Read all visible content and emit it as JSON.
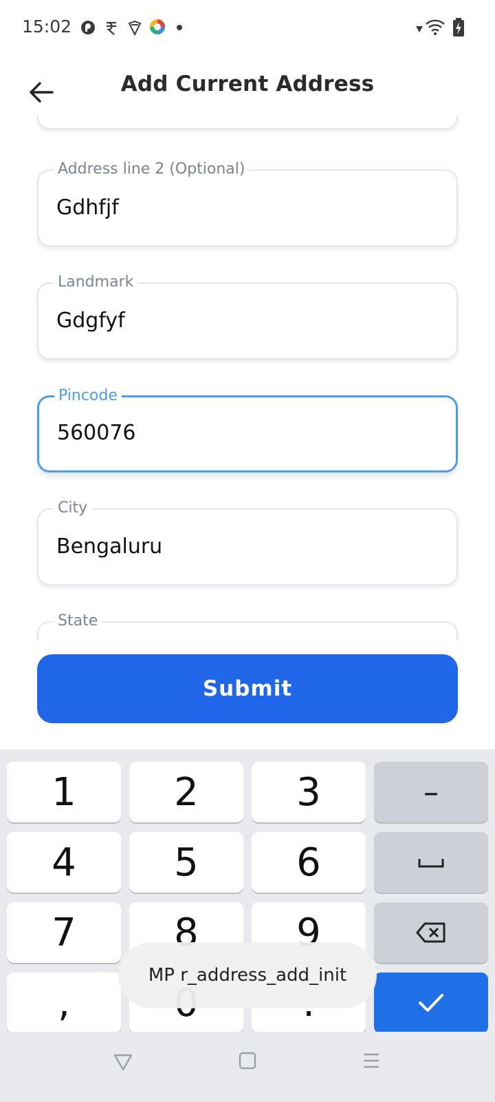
{
  "status_bar": {
    "time": "15:02",
    "left_icons": [
      "pocket-icon",
      "rupee-icon",
      "app-icon",
      "color-wheel-icon",
      "dot-icon"
    ],
    "right_icons": [
      "signal-icon",
      "wifi-icon",
      "battery-charging-icon"
    ]
  },
  "header": {
    "title": "Add Current Address",
    "back_icon": "arrow-left-icon"
  },
  "form": {
    "fields": [
      {
        "label": "Address line 2 (Optional)",
        "value": "Gdhfjf"
      },
      {
        "label": "Landmark",
        "value": "Gdgfyf"
      },
      {
        "label": "Pincode",
        "value": "560076",
        "active": true
      },
      {
        "label": "City",
        "value": "Bengaluru"
      },
      {
        "label": "State",
        "value": ""
      }
    ],
    "accent_color": "#4a9ef0"
  },
  "submit": {
    "label": "Submit",
    "color": "#1f67e8"
  },
  "keyboard": {
    "rows": [
      [
        "1",
        "2",
        "3",
        "–"
      ],
      [
        "4",
        "5",
        "6",
        "space-icon"
      ],
      [
        "7",
        "8",
        "9",
        "backspace-icon"
      ],
      [
        ",",
        "0",
        ".",
        "check-icon"
      ]
    ]
  },
  "toast": {
    "text": "MP r_address_add_init"
  },
  "nav_bar": {
    "icons": [
      "back-triangle-icon",
      "home-square-icon",
      "menu-lines-icon"
    ]
  }
}
